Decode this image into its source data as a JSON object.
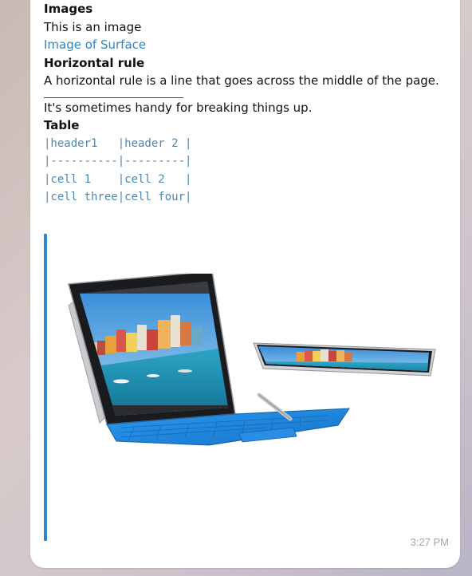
{
  "message": {
    "sections": [
      {
        "kind": "heading",
        "text": "Images"
      },
      {
        "kind": "text",
        "text": "This is an image"
      },
      {
        "kind": "link",
        "text": "Image of Surface"
      },
      {
        "kind": "heading",
        "text": "Horizontal rule"
      },
      {
        "kind": "text",
        "text": "A horizontal rule is a line that goes across the middle of the page."
      },
      {
        "kind": "text",
        "text": "It's sometimes handy for breaking things up."
      },
      {
        "kind": "heading",
        "text": "Table"
      }
    ],
    "table_lines": [
      "|header1   |header 2 |",
      "|----------|---------|",
      "|cell 1    |cell 2   |",
      "|cell three|cell four|"
    ],
    "image_subject": "surface-pro-laptop",
    "timestamp": "3:27 PM"
  },
  "colors": {
    "link": "#2e86c1",
    "quote_bar": "#2b8ac6",
    "keyboard_blue": "#1e8fe0"
  }
}
